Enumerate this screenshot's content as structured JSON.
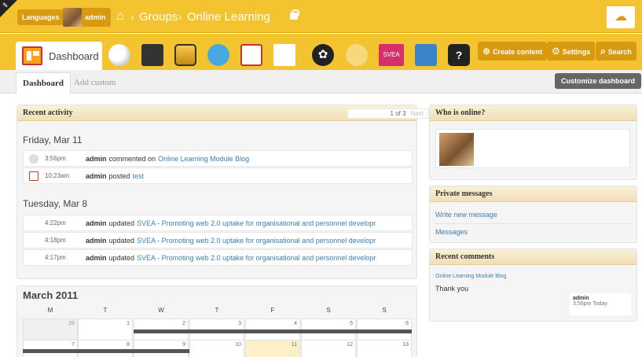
{
  "topbar": {
    "languages_label": "Languages",
    "user_name": "admin",
    "breadcrumb": [
      "Groups",
      "Online Learning"
    ]
  },
  "appbar": {
    "dashboard_label": "Dashboard",
    "app_icons": [
      "blog-icon",
      "notebook-icon",
      "photos-icon",
      "twitter-icon",
      "calendar-icon",
      "notes-icon",
      "pets-icon",
      "profile-icon",
      "svea-icon",
      "files-icon",
      "help-icon"
    ],
    "svea_label": "SVEA",
    "help_label": "?",
    "create_label": "Create content",
    "settings_label": "Settings",
    "search_label": "Search"
  },
  "tabs": {
    "dashboard": "Dashboard",
    "add_custom": "Add custom",
    "customize": "Customize dashboard"
  },
  "recent_activity": {
    "title": "Recent activity",
    "pager": "1 of 3",
    "next": "Next",
    "days": [
      {
        "label": "Friday, Mar 11",
        "items": [
          {
            "time": "3:56pm",
            "user": "admin",
            "verb": "commented on",
            "link": "Online Learning Module Blog"
          },
          {
            "time": "10:23am",
            "user": "admin",
            "verb": "posted",
            "link": "test"
          }
        ]
      },
      {
        "label": "Tuesday, Mar 8",
        "items": [
          {
            "time": "4:22pm",
            "user": "admin",
            "verb": "updated",
            "link": "SVEA - Promoting web 2.0 uptake for organisational and personnel developr"
          },
          {
            "time": "4:18pm",
            "user": "admin",
            "verb": "updated",
            "link": "SVEA - Promoting web 2.0 uptake for organisational and personnel developr"
          },
          {
            "time": "4:17pm",
            "user": "admin",
            "verb": "updated",
            "link": "SVEA - Promoting web 2.0 uptake for organisational and personnel developr"
          }
        ]
      }
    ]
  },
  "calendar": {
    "title": "March 2011",
    "dow": [
      "M",
      "T",
      "W",
      "T",
      "F",
      "S",
      "S"
    ],
    "week1": [
      "28",
      "1",
      "2",
      "3",
      "4",
      "5",
      "6"
    ],
    "week2": [
      "7",
      "8",
      "9",
      "10",
      "11",
      "12",
      "13"
    ]
  },
  "who_online": {
    "title": "Who is online?"
  },
  "private_messages": {
    "title": "Private messages",
    "write": "Write new message",
    "messages": "Messages"
  },
  "recent_comments": {
    "title": "Recent comments",
    "link": "Online Learning Module Blog",
    "text": "Thank you",
    "user": "admin",
    "time": "3:56pm Today"
  }
}
